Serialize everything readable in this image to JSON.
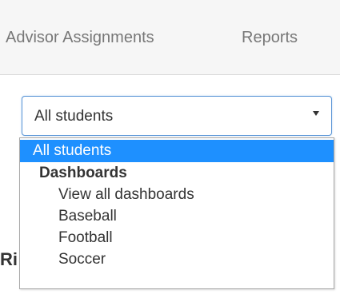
{
  "nav": {
    "advisor_assignments": "Advisor Assignments",
    "reports": "Reports"
  },
  "select": {
    "value": "All students"
  },
  "background_heading": "Ri",
  "dropdown": {
    "selected": "All students",
    "group_label": "Dashboards",
    "options": [
      "View all dashboards",
      "Baseball",
      "Football",
      "Soccer"
    ]
  },
  "colors": {
    "selected_bg": "#1e90ff",
    "select_border": "#5a95d6",
    "nav_text": "#777777"
  }
}
